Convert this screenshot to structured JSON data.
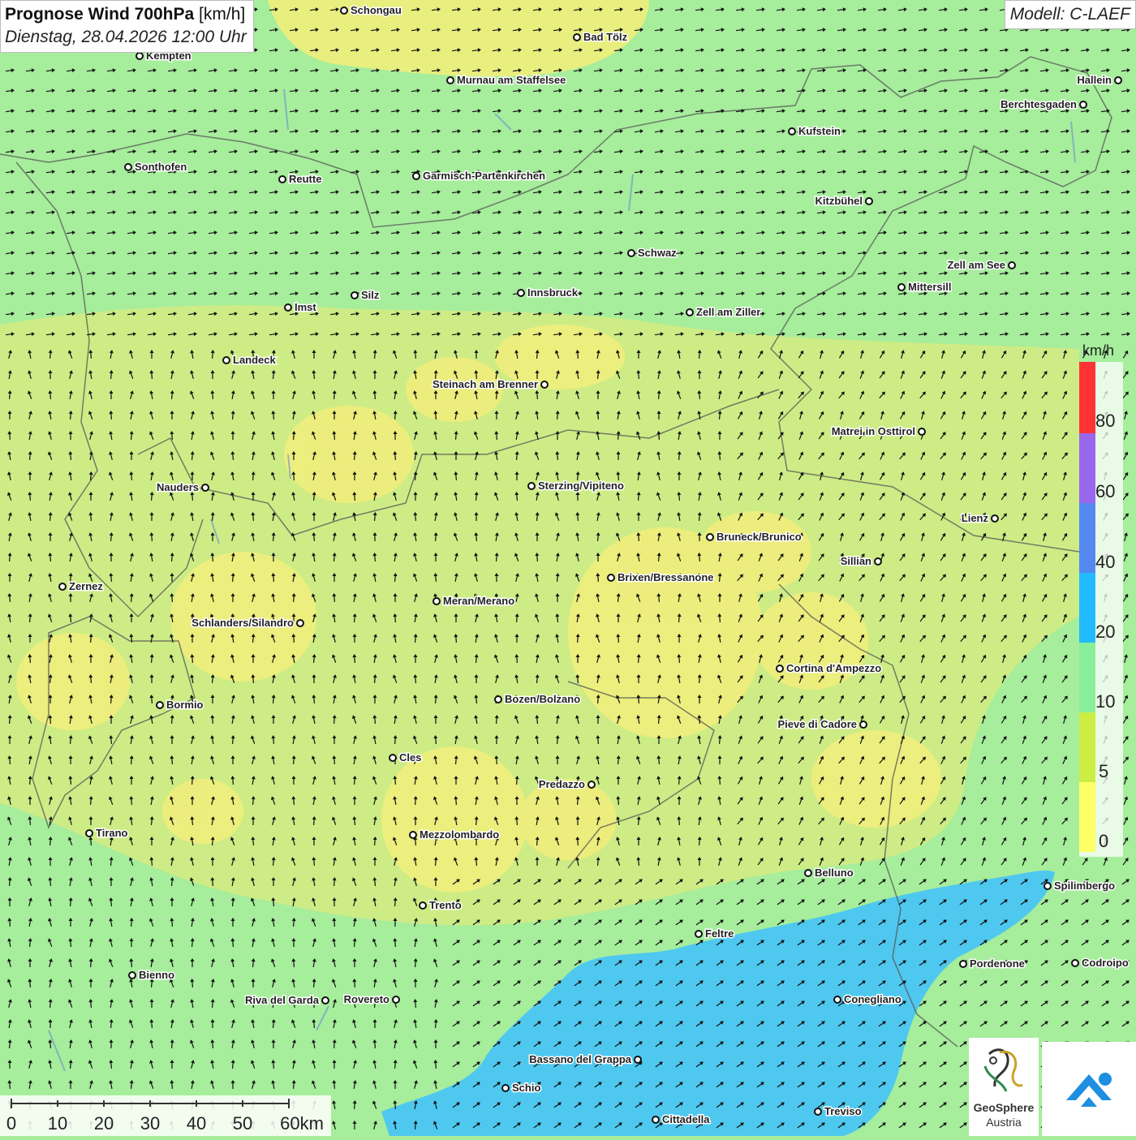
{
  "header": {
    "title_bold": "Prognose Wind 700hPa",
    "title_unit": "[km/h]",
    "datetime": "Dienstag, 28.04.2026 12:00 Uhr",
    "model": "Modell: C-LAEF"
  },
  "legend": {
    "unit": "km/h",
    "ticks": [
      "80",
      "60",
      "40",
      "20",
      "10",
      "5",
      "0"
    ],
    "colors": [
      "#ff3333",
      "#9966ee",
      "#5588ee",
      "#22bbff",
      "#88ee99",
      "#ccee44",
      "#ffff66"
    ]
  },
  "scalebar": {
    "labels": [
      "0",
      "10",
      "20",
      "30",
      "40",
      "50",
      "60km"
    ]
  },
  "logo": {
    "name1": "GeoSphere",
    "name2": "Austria"
  },
  "cities": [
    {
      "name": "Schongau"
    },
    {
      "name": "Bad Tölz"
    },
    {
      "name": "Kempten"
    },
    {
      "name": "Murnau am Staffelsee"
    },
    {
      "name": "Hallein"
    },
    {
      "name": "Berchtesgaden"
    },
    {
      "name": "Kufstein"
    },
    {
      "name": "Sonthofen"
    },
    {
      "name": "Reutte"
    },
    {
      "name": "Garmisch-Partenkirchen"
    },
    {
      "name": "Kitzbühel"
    },
    {
      "name": "Schwaz"
    },
    {
      "name": "Zell am See"
    },
    {
      "name": "Mittersill"
    },
    {
      "name": "Innsbruck"
    },
    {
      "name": "Silz"
    },
    {
      "name": "Imst"
    },
    {
      "name": "Zell am Ziller"
    },
    {
      "name": "Landeck"
    },
    {
      "name": "Steinach am Brenner"
    },
    {
      "name": "Matrei in Osttirol"
    },
    {
      "name": "Nauders"
    },
    {
      "name": "Sterzing/Vipiteno"
    },
    {
      "name": "Lienz"
    },
    {
      "name": "Bruneck/Brunico"
    },
    {
      "name": "Sillian"
    },
    {
      "name": "Brixen/Bressanone"
    },
    {
      "name": "Zernez"
    },
    {
      "name": "Meran/Merano"
    },
    {
      "name": "Schlanders/Silandro"
    },
    {
      "name": "Cortina d'Ampezzo"
    },
    {
      "name": "Bormio"
    },
    {
      "name": "Bozen/Bolzano"
    },
    {
      "name": "Pieve di Cadore"
    },
    {
      "name": "Cles"
    },
    {
      "name": "Predazzo"
    },
    {
      "name": "Tirano"
    },
    {
      "name": "Mezzolombardo"
    },
    {
      "name": "Belluno"
    },
    {
      "name": "Spilimbergo"
    },
    {
      "name": "Trento"
    },
    {
      "name": "Feltre"
    },
    {
      "name": "Pordenone"
    },
    {
      "name": "Codroipo"
    },
    {
      "name": "Bienno"
    },
    {
      "name": "Riva del Garda"
    },
    {
      "name": "Rovereto"
    },
    {
      "name": "Conegliano"
    },
    {
      "name": "Bassano del Grappa"
    },
    {
      "name": "Schio"
    },
    {
      "name": "Treviso"
    },
    {
      "name": "Cittadella"
    }
  ]
}
